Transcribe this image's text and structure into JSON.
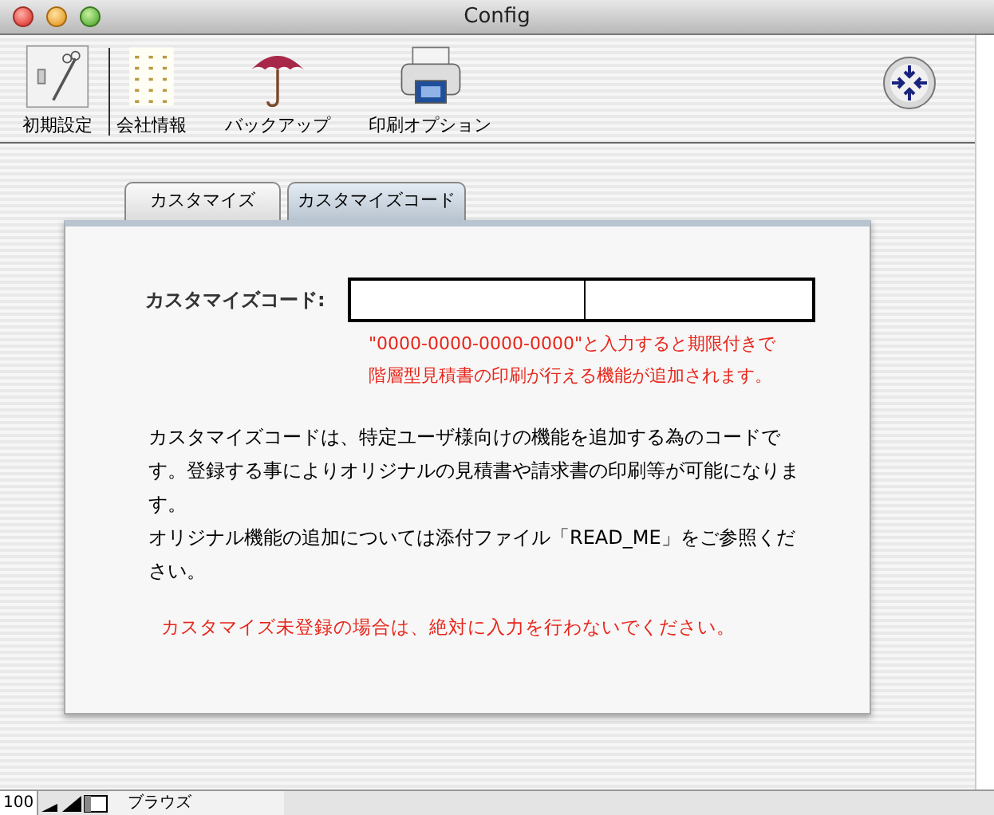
{
  "window": {
    "title": "Config"
  },
  "toolbar": {
    "items": [
      {
        "label": "初期設定",
        "kind": "settings"
      },
      {
        "label": "会社情報",
        "kind": "company"
      },
      {
        "label": "バックアップ",
        "kind": "backup"
      },
      {
        "label": "印刷オプション",
        "kind": "print"
      }
    ]
  },
  "tabs": [
    {
      "label": "カスタマイズ",
      "selected": false
    },
    {
      "label": "カスタマイズコード",
      "selected": true
    }
  ],
  "form": {
    "label": "カスタマイズコード:",
    "notes": [
      "\"0000-0000-0000-0000\"と入力すると期限付きで",
      "階層型見積書の印刷が行える機能が追加されます。"
    ]
  },
  "description": [
    "カスタマイズコードは、特定ユーザ様向けの機能を追加する為のコードです。登録する事によりオリジナルの見積書や請求書の印刷等が可能になります。",
    "オリジナル機能の追加については添付ファイル「READ_ME」をご参照ください。"
  ],
  "warning": "カスタマイズ未登録の場合は、絶対に入力を行わないでください。",
  "status_bar": {
    "zoom": "100",
    "mode": "ブラウズ"
  }
}
